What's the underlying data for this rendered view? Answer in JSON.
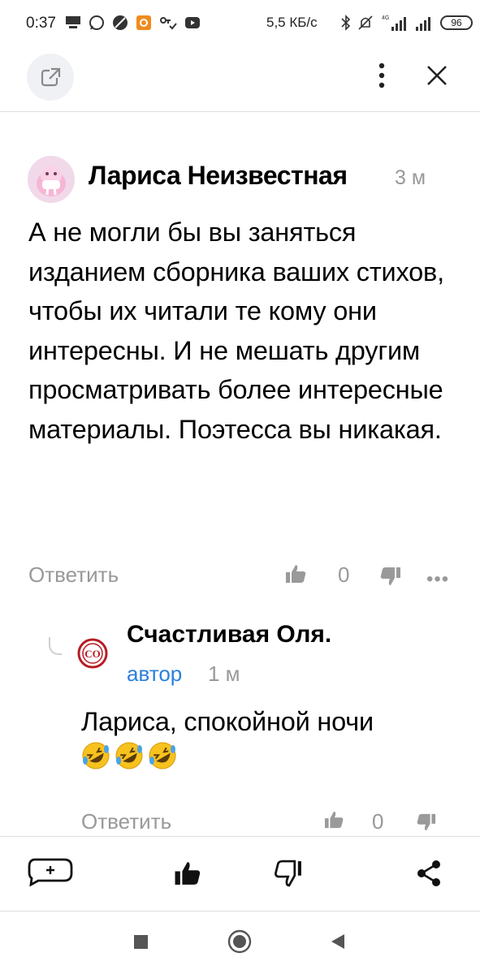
{
  "status_bar": {
    "time": "0:37",
    "speed": "5,5 КБ/с",
    "battery": "96"
  },
  "top_bar": {
    "share_icon": "external-link-icon",
    "more_icon": "more-vertical-icon",
    "close_icon": "close-icon"
  },
  "comment": {
    "author": "Лариса Неизвестная",
    "time": "3 м",
    "text": "А не могли бы вы заняться изданием сборника ваших стихов, чтобы их читали те кому они интересны. И не мешать другим просматривать более интересные материалы. Поэтесса вы никакая.",
    "reply_label": "Ответить",
    "likes": "0",
    "more": "•••"
  },
  "reply": {
    "author": "Счастливая Оля.",
    "badge": "автор",
    "time": "1 м",
    "avatar_text": "CO",
    "text": "Лариса, спокойной ночи",
    "emojis": [
      "🤣",
      "🤣",
      "🤣"
    ],
    "reply_label": "Ответить",
    "likes": "0"
  },
  "toolbar": {
    "comment_icon": "add-comment-icon",
    "like_icon": "thumbs-up-icon",
    "dislike_icon": "thumbs-down-icon",
    "share_icon": "share-icon"
  },
  "colors": {
    "accent_link": "#2a7fde",
    "muted_text": "#999999",
    "avatar_bg": "#f1d9ea"
  }
}
